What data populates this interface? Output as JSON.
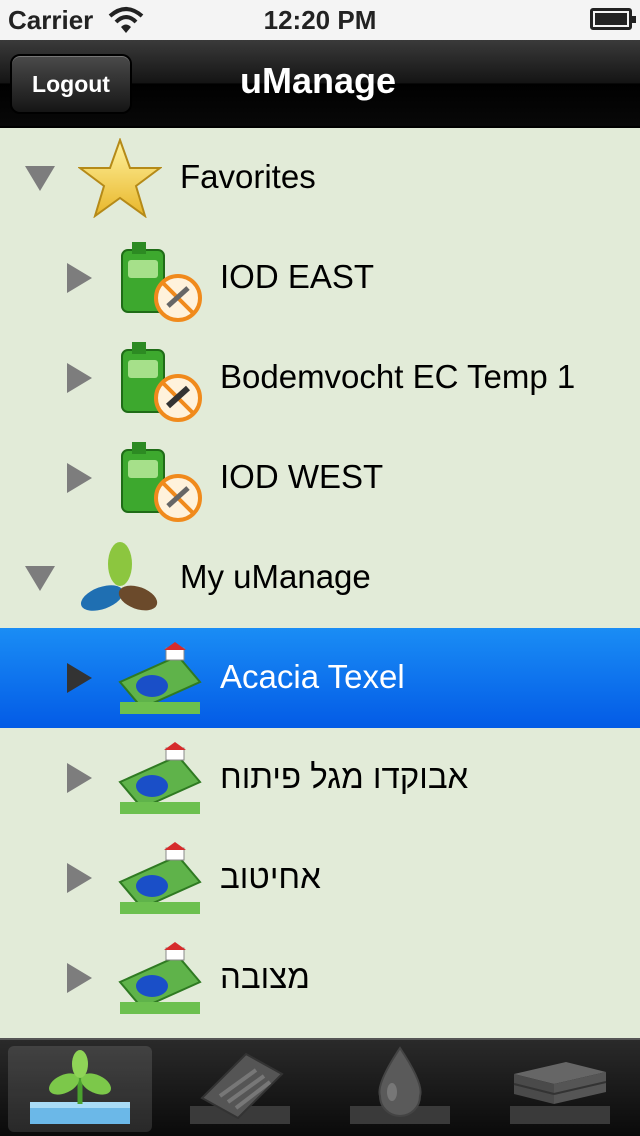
{
  "status_bar": {
    "carrier": "Carrier",
    "time": "12:20 PM"
  },
  "nav": {
    "title": "uManage",
    "logout_label": "Logout"
  },
  "tree": {
    "favorites": {
      "label": "Favorites",
      "icon": "star-icon",
      "expanded": true,
      "items": [
        {
          "label": "IOD EAST",
          "icon": "sensor-icon"
        },
        {
          "label": "Bodemvocht EC Temp 1",
          "icon": "sensor-icon"
        },
        {
          "label": "IOD WEST",
          "icon": "sensor-icon"
        }
      ]
    },
    "my_umanage": {
      "label": "My uManage",
      "icon": "umanage-logo-icon",
      "expanded": true,
      "items": [
        {
          "label": "Acacia Texel",
          "icon": "farm-field-icon",
          "selected": true
        },
        {
          "label": "אבוקדו מגל פיתוח",
          "icon": "farm-field-icon"
        },
        {
          "label": "אחיטוב",
          "icon": "farm-field-icon"
        },
        {
          "label": "מצובה",
          "icon": "farm-field-icon"
        }
      ]
    }
  },
  "tab_bar": {
    "tabs": [
      {
        "icon": "plant-icon",
        "active": true
      },
      {
        "icon": "notepad-icon",
        "active": false
      },
      {
        "icon": "water-drop-icon",
        "active": false
      },
      {
        "icon": "soil-layers-icon",
        "active": false
      }
    ]
  },
  "colors": {
    "background": "#e2ebd8",
    "selection": "#0a6ff0",
    "navbar": "#141414"
  }
}
